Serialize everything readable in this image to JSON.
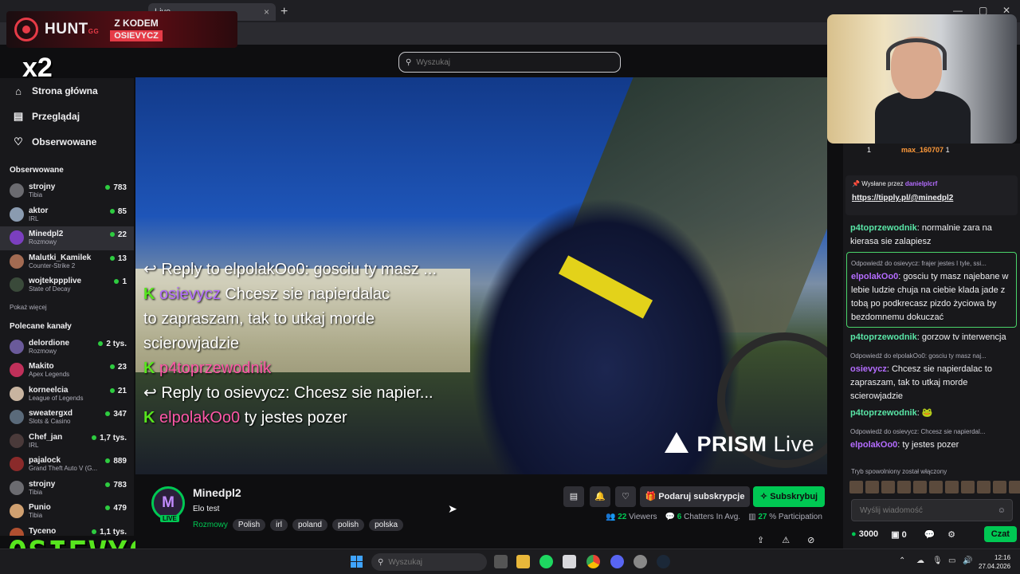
{
  "browser": {
    "tab_title": "Live",
    "new_tab": "+",
    "tab_close": "×"
  },
  "promo": {
    "brand": "HUNT",
    "brand_suffix": "GG",
    "code_line1": "Z KODEM",
    "code_line2": "OSIEVYCZ",
    "multiplier": "x2"
  },
  "search": {
    "placeholder": "Wyszukaj"
  },
  "nav": {
    "home": "Strona główna",
    "browse": "Przeglądaj",
    "following": "Obserwowane"
  },
  "sidebar": {
    "following_header": "Obserwowane",
    "following": [
      {
        "name": "strojny",
        "game": "Tibia",
        "viewers": "783",
        "color": "#6b6b70"
      },
      {
        "name": "aktor",
        "game": "IRL",
        "viewers": "85",
        "color": "#8a9bb0"
      },
      {
        "name": "Minedpl2",
        "game": "Rozmowy",
        "viewers": "22",
        "color": "#7b3fbf"
      },
      {
        "name": "Malutki_Kamilek",
        "game": "Counter-Strike 2",
        "viewers": "13",
        "color": "#a36b52"
      },
      {
        "name": "wojtekppplive",
        "game": "State of Decay",
        "viewers": "1",
        "color": "#3a4a3a"
      }
    ],
    "show_more": "Pokaż więcej",
    "recommended_header": "Polecane kanały",
    "recommended": [
      {
        "name": "delordione",
        "game": "Rozmowy",
        "viewers": "2 tys.",
        "color": "#6a5a9a"
      },
      {
        "name": "Makito",
        "game": "Apex Legends",
        "viewers": "23",
        "color": "#c0305a"
      },
      {
        "name": "korneelcia",
        "game": "League of Legends",
        "viewers": "21",
        "color": "#c8b4a0"
      },
      {
        "name": "sweatergxd",
        "game": "Slots & Casino",
        "viewers": "347",
        "color": "#5a6a7a"
      },
      {
        "name": "Chef_jan",
        "game": "IRL",
        "viewers": "1,7 tys.",
        "color": "#4a3a3a"
      },
      {
        "name": "pajalock",
        "game": "Grand Theft Auto V (G...",
        "viewers": "889",
        "color": "#8a2a2a"
      },
      {
        "name": "strojny",
        "game": "Tibia",
        "viewers": "783",
        "color": "#6b6b70"
      },
      {
        "name": "Punio",
        "game": "Tibia",
        "viewers": "479",
        "color": "#d0a070"
      },
      {
        "name": "Tyceno",
        "game": "",
        "viewers": "1,1 tys.",
        "color": "#b05030"
      }
    ],
    "overlay_name": "OSIEVYCZ"
  },
  "video_overlay": {
    "line1": "Reply to elpolakOo0: gosciu ty masz ...",
    "line2_user": "osievycz",
    "line2_text": "Chcesz sie napierdalac",
    "line3": "to zapraszam, tak to utkaj morde",
    "line4": "scierowjadzie",
    "line5_user": "p4toprzewodnik",
    "line6": "Reply to osievycz: Chcesz sie napier...",
    "line7_user": "elpolakOo0",
    "line7_text": "ty jestes pozer",
    "watermark_brand": "PRISM",
    "watermark_suffix": "Live"
  },
  "channel": {
    "name": "Minedpl2",
    "avatar_letter": "M",
    "live_badge": "LIVE",
    "title": "Elo test",
    "category": "Rozmowy",
    "tags": [
      "Polish",
      "irl",
      "poland",
      "polish",
      "polska"
    ],
    "gift_button": "Podaruj subskrypcje",
    "subscribe_button": "Subskrybuj",
    "viewers": "22",
    "viewers_label": "Viewers",
    "chatters": "6",
    "chatters_label": "Chatters In Avg.",
    "participation": "27",
    "participation_label": "% Participation"
  },
  "chat": {
    "gift_user1": "1",
    "gift_user2": "max_160707",
    "gift_count2": "1",
    "pinned_by_label": "Wysłane przez",
    "pinned_by_user": "danielplcrf",
    "pinned_link": "https://tipply.pl/@minedpl2",
    "messages": [
      {
        "user": "p4toprzewodnik",
        "text": ": normalnie zara na kierasa sie zalapiesz"
      },
      {
        "reply": "Odpowiedź do osievycz: frajer jestes I tyle, ssi...",
        "user": "elpolakOo0",
        "text": ": gosciu ty masz najebane w lebie ludzie chuja na ciebie klada jade z tobą po podkrecasz pizdo życiowa by bezdomnemu dokuczać"
      },
      {
        "user": "p4toprzewodnik",
        "text": ": gorzow tv interwencja"
      },
      {
        "reply": "Odpowiedź do elpolakOo0: gosciu ty masz naj...",
        "user": "osievycz",
        "text": ": Chcesz sie napierdalac to zapraszam, tak to utkaj morde scierowjadzie"
      },
      {
        "user": "p4toprzewodnik",
        "text": ":"
      },
      {
        "reply": "Odpowiedź do osievycz: Chcesz sie napierdal...",
        "user": "elpolakOo0",
        "text": ": ty jestes pozer"
      }
    ],
    "slow_mode": "Tryb spowolniony został włączony",
    "input_placeholder": "Wyślij wiadomość",
    "points": "3000",
    "counter": "0",
    "chat_button": "Czat"
  },
  "taskbar": {
    "search_placeholder": "Wyszukaj",
    "time": "12:16",
    "date": "27.04.2026"
  }
}
